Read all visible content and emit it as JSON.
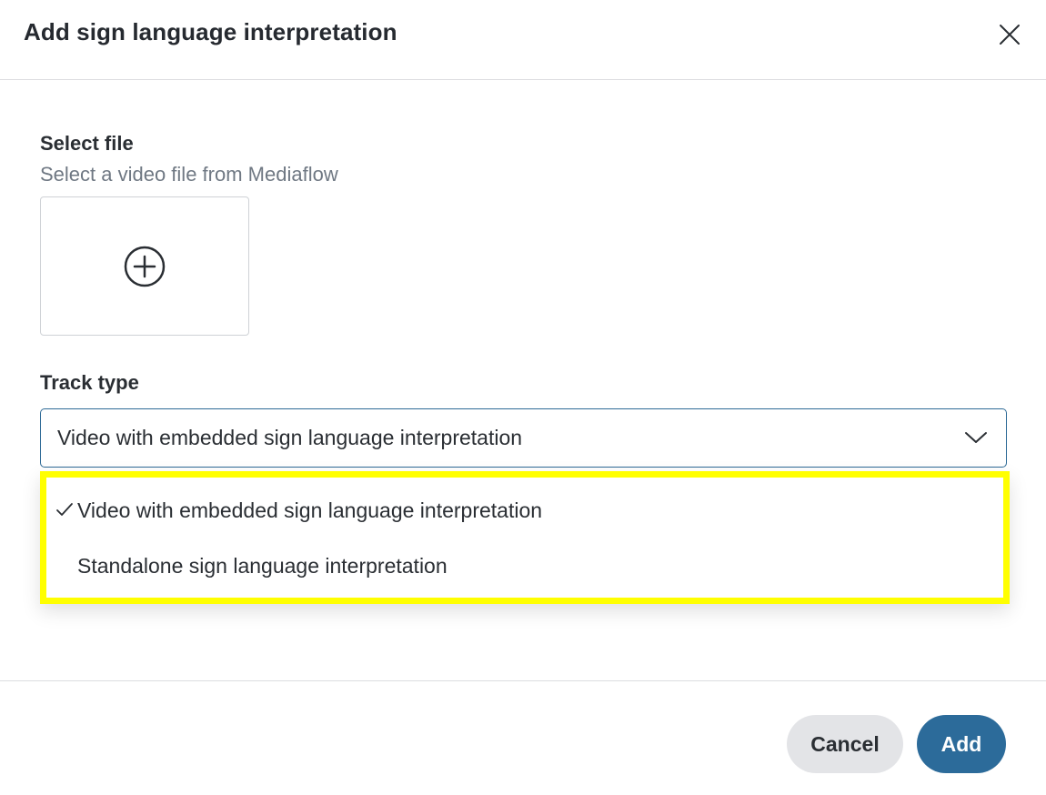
{
  "dialog": {
    "title": "Add sign language interpretation",
    "close_icon": "close-icon"
  },
  "select_file": {
    "label": "Select file",
    "helper": "Select a video file from Mediaflow",
    "icon": "plus-circle-icon"
  },
  "track_type": {
    "label": "Track type",
    "selected": "Video with embedded sign language interpretation",
    "chevron_icon": "chevron-down-icon",
    "options": [
      {
        "label": "Video with embedded sign language interpretation",
        "checked": true
      },
      {
        "label": "Standalone sign language interpretation",
        "checked": false
      }
    ],
    "highlight_color": "#ffff00"
  },
  "footer": {
    "cancel_label": "Cancel",
    "add_label": "Add"
  },
  "colors": {
    "primary": "#2c6b9a",
    "secondary_bg": "#e3e4e7",
    "helper_text": "#6f7883",
    "focus_border": "#2e6a96"
  }
}
